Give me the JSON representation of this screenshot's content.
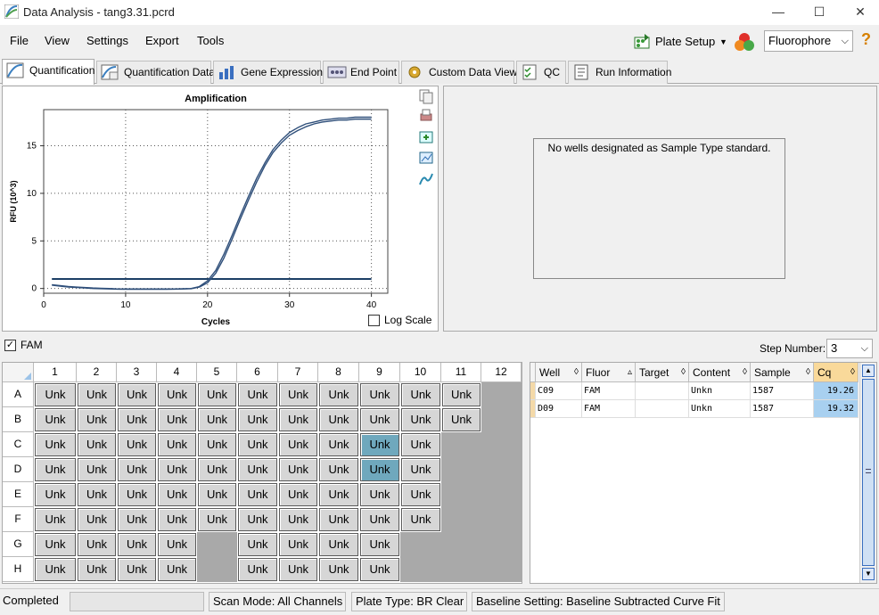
{
  "window": {
    "title": "Data Analysis - tang3.31.pcrd",
    "minimize": "—",
    "maximize": "☐",
    "close": "✕"
  },
  "menu": {
    "items": [
      "File",
      "View",
      "Settings",
      "Export",
      "Tools"
    ]
  },
  "toolbar": {
    "plate_setup": "Plate Setup",
    "fluorophore": "Fluorophore",
    "help": "?"
  },
  "tabs": [
    "Quantification",
    "Quantification Data",
    "Gene Expression",
    "End Point",
    "Custom Data View",
    "QC",
    "Run Information"
  ],
  "chart_data": {
    "type": "line",
    "title": "Amplification",
    "xlabel": "Cycles",
    "ylabel": "RFU (10^3)",
    "xlim": [
      0,
      42
    ],
    "ylim": [
      -0.5,
      18.8
    ],
    "xticks": [
      0,
      10,
      20,
      30,
      40
    ],
    "yticks": [
      0,
      5,
      10,
      15
    ],
    "grid": true,
    "threshold": 1.0,
    "series": [
      {
        "x": [
          1,
          2,
          3,
          4,
          5,
          6,
          7,
          8,
          9,
          10,
          11,
          12,
          13,
          14,
          15,
          16,
          17,
          18,
          19,
          20,
          21,
          22,
          23,
          24,
          25,
          26,
          27,
          28,
          29,
          30,
          31,
          32,
          33,
          34,
          35,
          36,
          37,
          38,
          39,
          40
        ],
        "values": [
          0.4,
          0.3,
          0.2,
          0.15,
          0.1,
          0.05,
          0.02,
          0,
          -0.05,
          -0.05,
          -0.05,
          -0.05,
          -0.05,
          -0.05,
          -0.05,
          -0.05,
          -0.03,
          0,
          0.2,
          0.8,
          1.9,
          3.6,
          5.6,
          7.7,
          9.7,
          11.6,
          13.2,
          14.6,
          15.6,
          16.4,
          16.9,
          17.3,
          17.5,
          17.7,
          17.8,
          17.9,
          17.9,
          18,
          18,
          18
        ]
      },
      {
        "x": [
          1,
          2,
          3,
          4,
          5,
          6,
          7,
          8,
          9,
          10,
          11,
          12,
          13,
          14,
          15,
          16,
          17,
          18,
          19,
          20,
          21,
          22,
          23,
          24,
          25,
          26,
          27,
          28,
          29,
          30,
          31,
          32,
          33,
          34,
          35,
          36,
          37,
          38,
          39,
          40
        ],
        "values": [
          0.35,
          0.25,
          0.15,
          0.1,
          0.05,
          0,
          -0.02,
          -0.05,
          -0.07,
          -0.08,
          -0.08,
          -0.08,
          -0.08,
          -0.08,
          -0.08,
          -0.07,
          -0.05,
          -0.02,
          0.15,
          0.6,
          1.6,
          3.2,
          5.2,
          7.3,
          9.3,
          11.2,
          12.9,
          14.3,
          15.3,
          16.1,
          16.6,
          17,
          17.3,
          17.5,
          17.6,
          17.7,
          17.7,
          17.8,
          17.8,
          17.8
        ]
      }
    ]
  },
  "chart": {
    "log_scale_label": "Log Scale",
    "log_scale_checked": false
  },
  "standard_panel": {
    "message": "No wells designated as Sample Type standard."
  },
  "fam": {
    "label": "FAM",
    "checked": true
  },
  "step": {
    "label": "Step Number:",
    "value": "3"
  },
  "plate": {
    "columns": [
      "1",
      "2",
      "3",
      "4",
      "5",
      "6",
      "7",
      "8",
      "9",
      "10",
      "11",
      "12"
    ],
    "rows": [
      "A",
      "B",
      "C",
      "D",
      "E",
      "F",
      "G",
      "H"
    ],
    "well_label": "Unk",
    "row_cols": {
      "A": [
        1,
        2,
        3,
        4,
        5,
        6,
        7,
        8,
        9,
        10,
        11
      ],
      "B": [
        1,
        2,
        3,
        4,
        5,
        6,
        7,
        8,
        9,
        10,
        11
      ],
      "C": [
        1,
        2,
        3,
        4,
        5,
        6,
        7,
        8,
        9,
        10
      ],
      "D": [
        1,
        2,
        3,
        4,
        5,
        6,
        7,
        8,
        9,
        10
      ],
      "E": [
        1,
        2,
        3,
        4,
        5,
        6,
        7,
        8,
        9,
        10
      ],
      "F": [
        1,
        2,
        3,
        4,
        5,
        6,
        7,
        8,
        9,
        10
      ],
      "G": [
        1,
        2,
        3,
        4,
        6,
        7,
        8,
        9
      ],
      "H": [
        1,
        2,
        3,
        4,
        6,
        7,
        8,
        9
      ]
    },
    "selected": [
      "C9",
      "D9"
    ]
  },
  "table": {
    "headers": [
      "Well",
      "Fluor",
      "Target",
      "Content",
      "Sample",
      "Cq"
    ],
    "rows": [
      {
        "well": "C09",
        "fluor": "FAM",
        "target": "",
        "content": "Unkn",
        "sample": "1587",
        "cq": "19.26"
      },
      {
        "well": "D09",
        "fluor": "FAM",
        "target": "",
        "content": "Unkn",
        "sample": "1587",
        "cq": "19.32"
      }
    ]
  },
  "status": {
    "state": "Completed",
    "scan_mode": "Scan Mode: All Channels",
    "plate_type": "Plate Type: BR Clear",
    "baseline": "Baseline Setting: Baseline Subtracted Curve Fit"
  },
  "colors": {
    "curve": "#2f4f7a",
    "threshold": "#1c3f66",
    "selected_well": "#6fa8bd",
    "cq_column": "#a8d0f0"
  }
}
